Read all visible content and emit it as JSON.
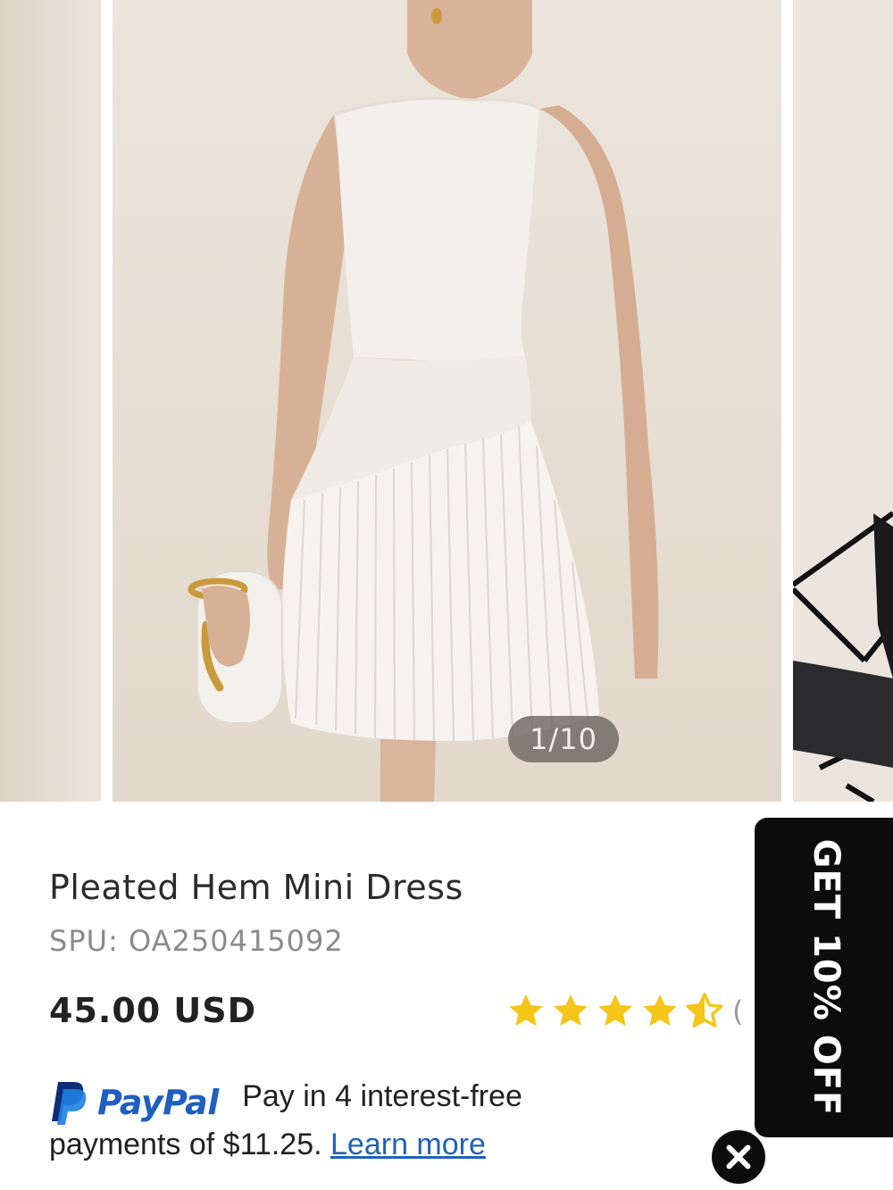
{
  "gallery": {
    "counter": "1/10",
    "image_current": 1,
    "image_total": 10
  },
  "product": {
    "title": "Pleated Hem Mini Dress",
    "spu": "SPU: OA250415092",
    "price": "45.00 USD",
    "rating_stars": 4.5,
    "rating_count_visible": "("
  },
  "paypal": {
    "brand": "PayPal",
    "line1": "Pay in 4 interest-free",
    "line2_prefix": "payments of $11.25. ",
    "link": "Learn more"
  },
  "promo": {
    "label": "GET 10% OFF"
  },
  "colors": {
    "star": "#f5c518",
    "paypal_blue": "#1f5fbf",
    "paypal_dark": "#0c2e7a",
    "link": "#1f63b5",
    "promo_bg": "#0c0c0c"
  },
  "icons": {
    "star": "star-icon",
    "half_star": "star-half-icon",
    "paypal": "paypal-logo-icon",
    "close": "close-icon"
  }
}
